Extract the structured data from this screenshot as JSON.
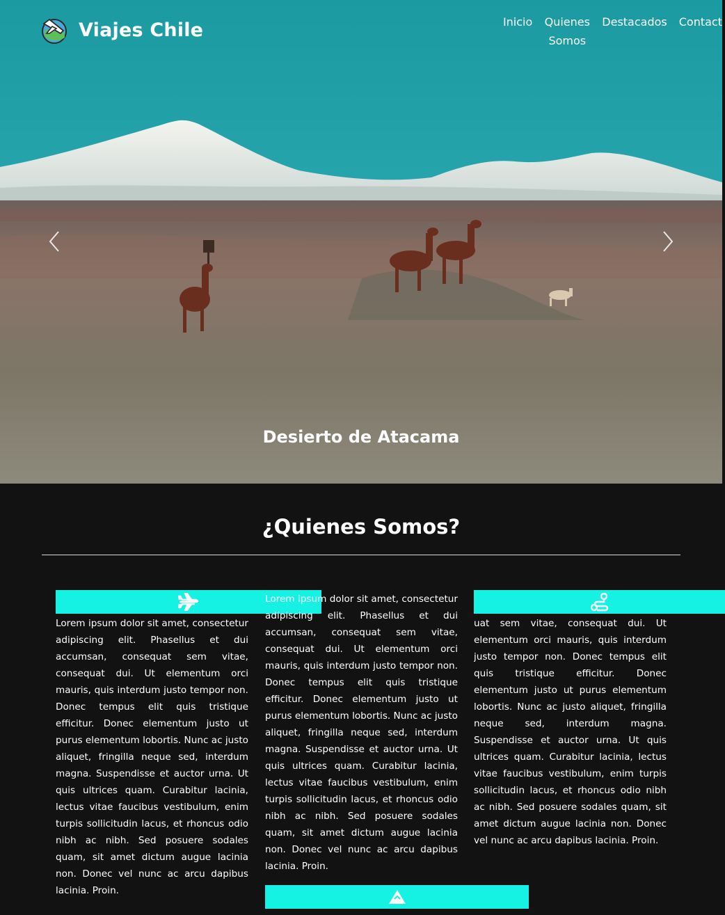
{
  "header": {
    "brand": "Viajes Chile",
    "nav": [
      {
        "label": "Inicio"
      },
      {
        "label": "Quienes Somos"
      },
      {
        "label": "Destacados"
      },
      {
        "label": "Contact"
      }
    ]
  },
  "carousel": {
    "caption": "Desierto de Atacama",
    "prev_icon": "chevron-left-icon",
    "next_icon": "chevron-right-icon"
  },
  "about": {
    "title": "¿Quienes Somos?",
    "accent_color": "#15f2e4",
    "col1_text": "Lorem ipsum dolor sit amet, consectetur adipiscing elit. Phasellus et dui accumsan, consequat sem vitae, consequat dui. Ut elementum orci mauris, quis interdum justo tempor non. Donec tempus elit quis tristique efficitur. Donec elementum justo ut purus elementum lobortis. Nunc ac justo aliquet, fringilla neque sed, interdum magna. Suspendisse et auctor urna. Ut quis ultrices quam. Curabitur lacinia, lectus vitae faucibus vestibulum, enim turpis sollicitudin lacus, et rhoncus odio nibh ac nibh. Sed posuere sodales quam, sit amet dictum augue lacinia non. Donec vel nunc ac arcu dapibus lacinia. Proin.",
    "col2_text": "Lorem ipsum dolor sit amet, consectetur adipiscing elit. Phasellus et dui accumsan, consequat sem vitae, consequat dui. Ut elementum orci mauris, quis interdum justo tempor non. Donec tempus elit quis tristique efficitur. Donec elementum justo ut purus elementum lobortis. Nunc ac justo aliquet, fringilla neque sed, interdum magna. Suspendisse et auctor urna. Ut quis ultrices quam. Curabitur lacinia, lectus vitae faucibus vestibulum, enim turpis sollicitudin lacus, et rhoncus odio nibh ac nibh. Sed posuere sodales quam, sit amet dictum augue lacinia non. Donec vel nunc ac arcu dapibus lacinia. Proin.",
    "col3_text": "uat sem vitae, consequat dui. Ut elementum orci mauris, quis interdum justo tempor non. Donec tempus elit quis tristique efficitur. Donec elementum justo ut purus elementum lobortis. Nunc ac justo aliquet, fringilla neque sed, interdum magna. Suspendisse et auctor urna. Ut quis ultrices quam. Curabitur lacinia, lectus vitae faucibus vestibulum, enim turpis sollicitudin lacus, et rhoncus odio nibh ac nibh. Sed posuere sodales quam, sit amet dictum augue lacinia non. Donec vel nunc ac arcu dapibus lacinia. Proin.",
    "icons": [
      "plane-icon",
      "route-icon",
      "mountain-icon"
    ]
  }
}
